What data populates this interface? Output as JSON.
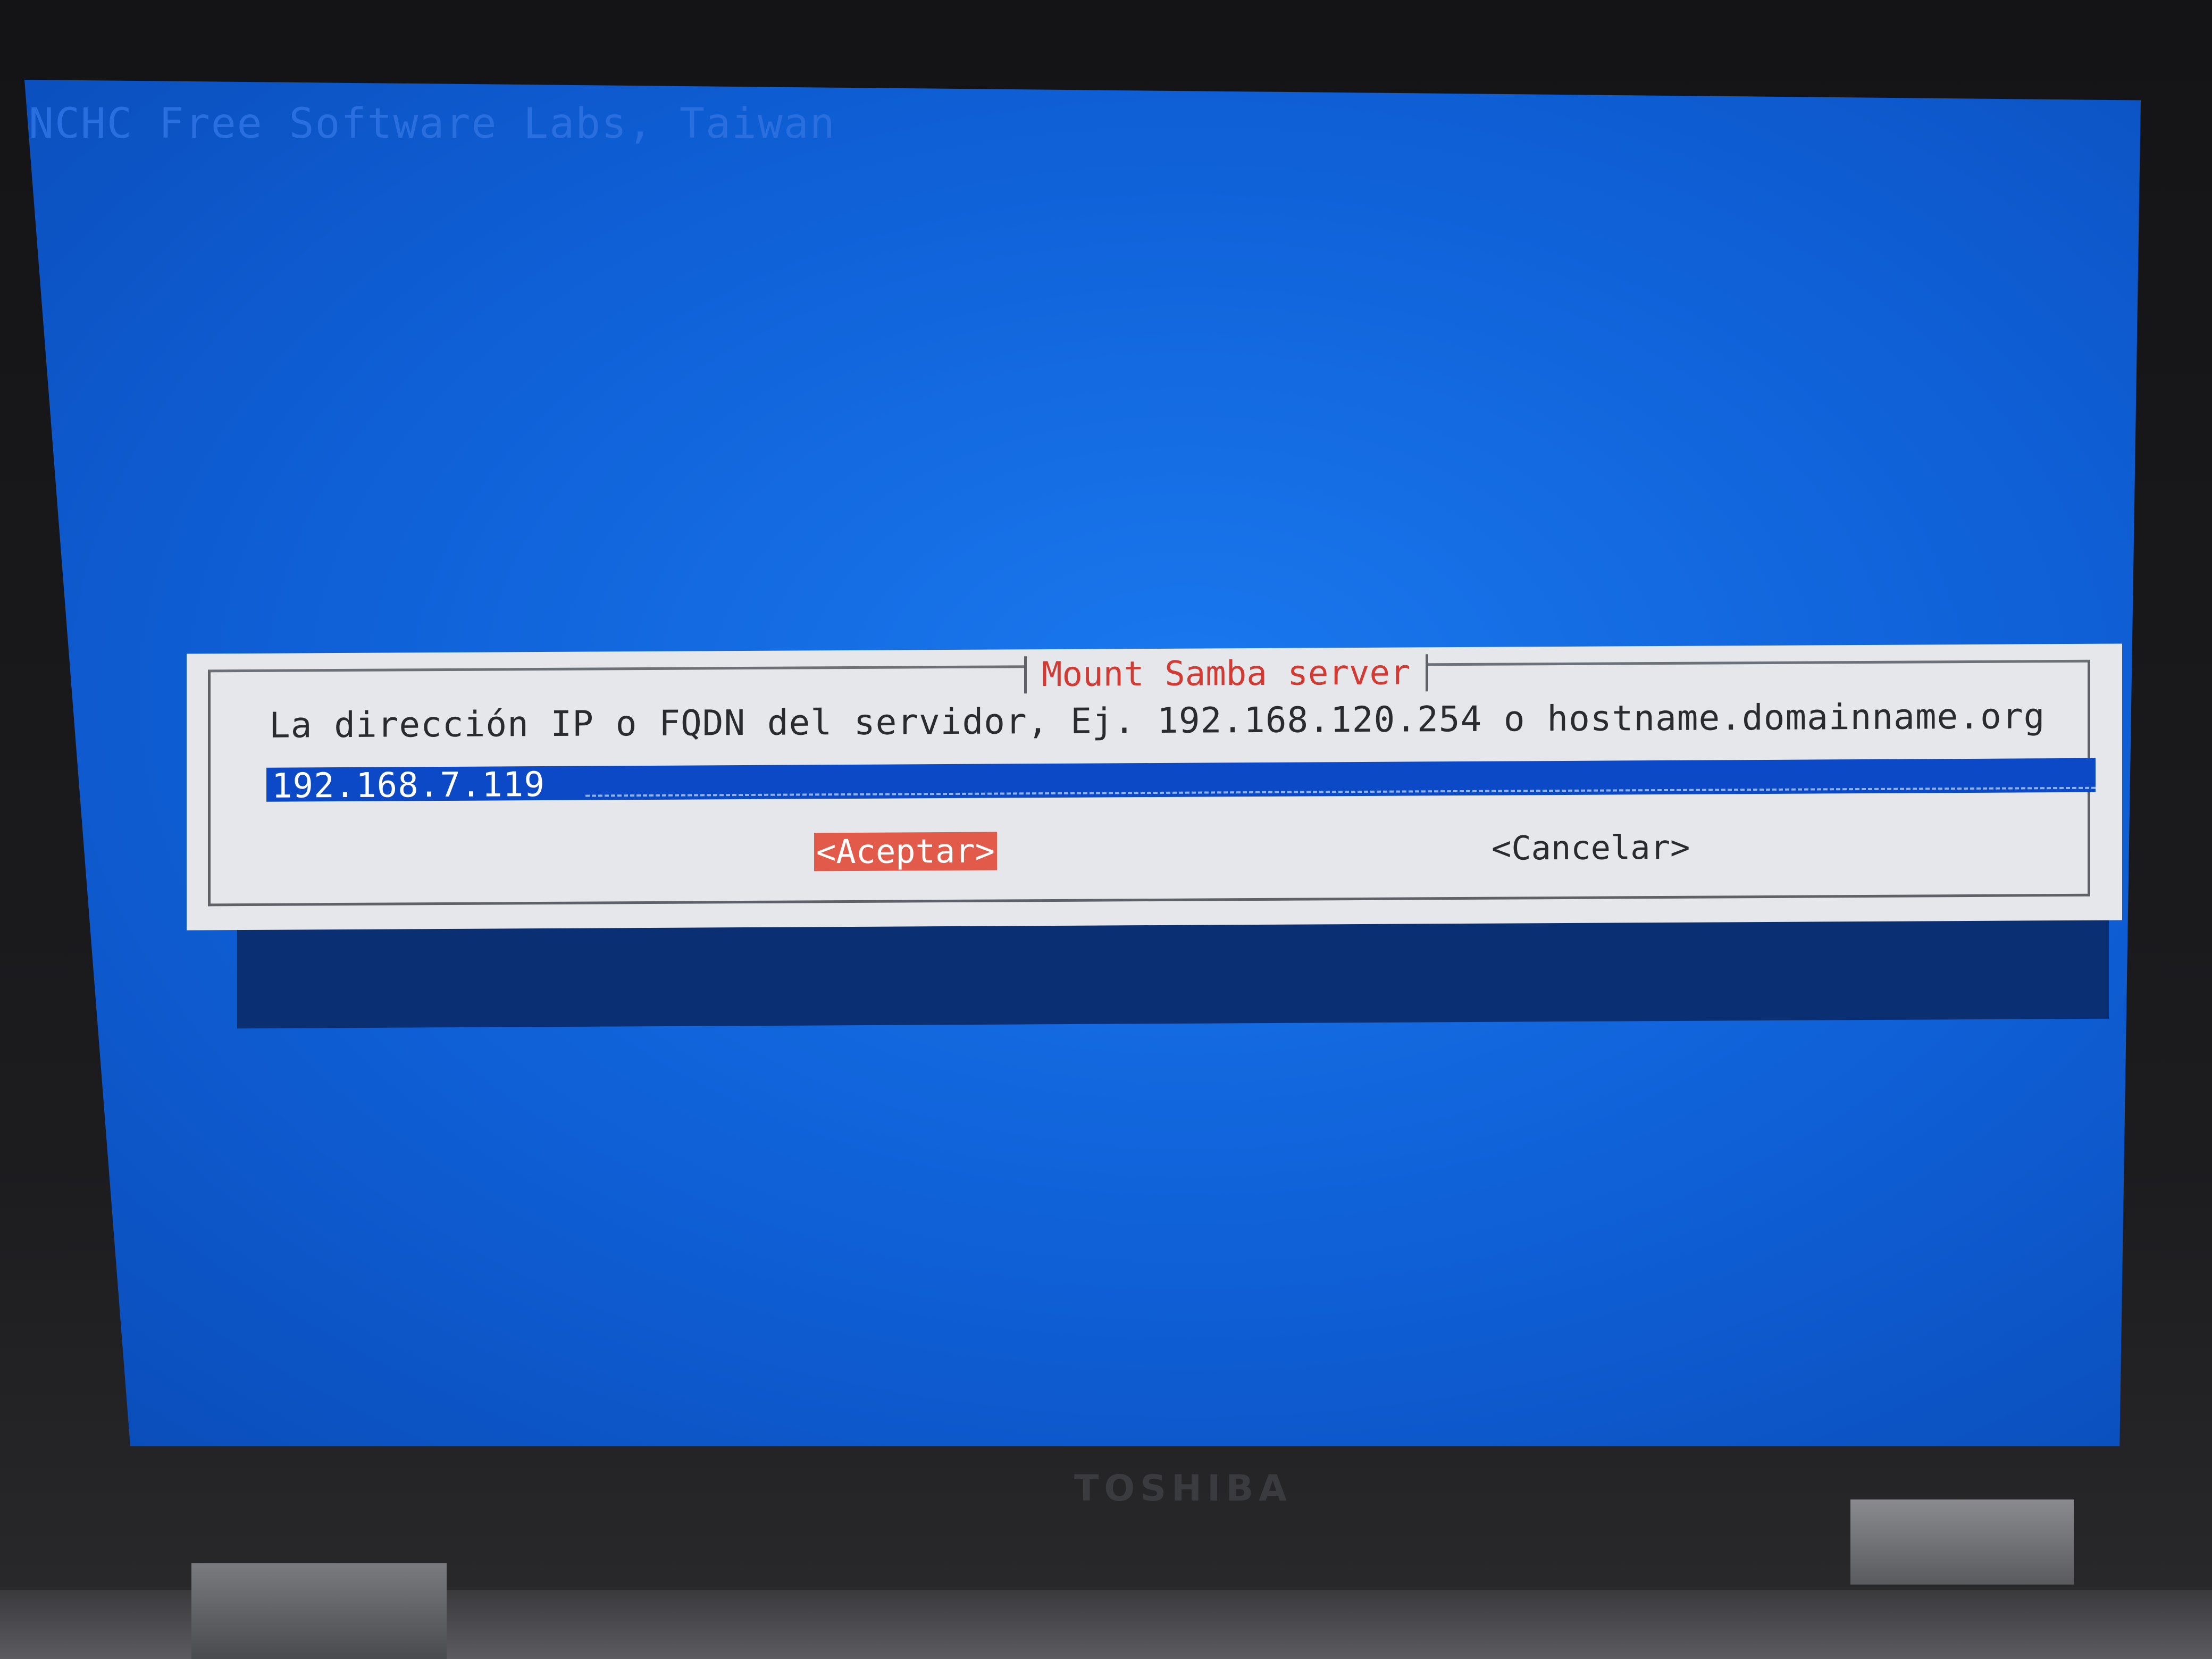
{
  "screen": {
    "backtitle": "NCHC Free Software Labs, Taiwan"
  },
  "dialog": {
    "title": "Mount Samba server",
    "prompt": "La dirección IP o FQDN del servidor, Ej. 192.168.120.254 o hostname.domainname.org",
    "input_value": "192.168.7.119",
    "ok_label": "<Aceptar>",
    "cancel_label": "<Cancelar>"
  },
  "device": {
    "brand": "TOSHIBA"
  },
  "colors": {
    "screen_bg": "#0f5fd6",
    "dialog_bg": "#e6e7ea",
    "title_text": "#d23a34",
    "input_bg": "#0c49c7",
    "ok_button_bg": "#e25a4a"
  }
}
